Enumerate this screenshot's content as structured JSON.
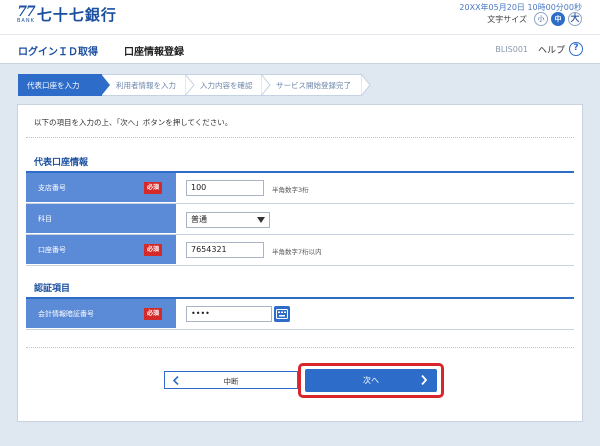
{
  "header": {
    "logo_number": "77",
    "logo_bank": "BANK",
    "bank_name": "七十七銀行",
    "datetime": "20XX年05月20日 10時00分00秒",
    "font_size_label": "文字サイズ",
    "font_sizes": [
      "小",
      "中",
      "大"
    ]
  },
  "titlebar": {
    "login_link": "ログインＩＤ取得",
    "screen_title": "口座情報登録",
    "screen_id": "BLIS001",
    "help_label": "ヘルプ",
    "help_icon_text": "?"
  },
  "steps": [
    "代表口座を入力",
    "利用者情報を入力",
    "入力内容を確認",
    "サービス開始登録完了"
  ],
  "instruction": "以下の項目を入力の上、「次へ」ボタンを押してください。",
  "account_section": {
    "title": "代表口座情報",
    "branch": {
      "label": "支店番号",
      "required": "必須",
      "value": "100",
      "hint": "半角数字3桁"
    },
    "subject": {
      "label": "科目",
      "value": "普通"
    },
    "account_number": {
      "label": "口座番号",
      "required": "必須",
      "value": "7654321",
      "hint": "半角数字7桁以内"
    }
  },
  "auth_section": {
    "title": "認証項目",
    "pin": {
      "label": "会計情報暗証番号",
      "required": "必須",
      "value": "••••"
    }
  },
  "buttons": {
    "back": "中断",
    "next": "次へ"
  },
  "colors": {
    "brand_blue": "#1a4fa0",
    "accent_blue": "#2d6cc8",
    "label_blue": "#5b8ad6",
    "required_red": "#d42a2a",
    "highlight_red": "#d9262c"
  }
}
